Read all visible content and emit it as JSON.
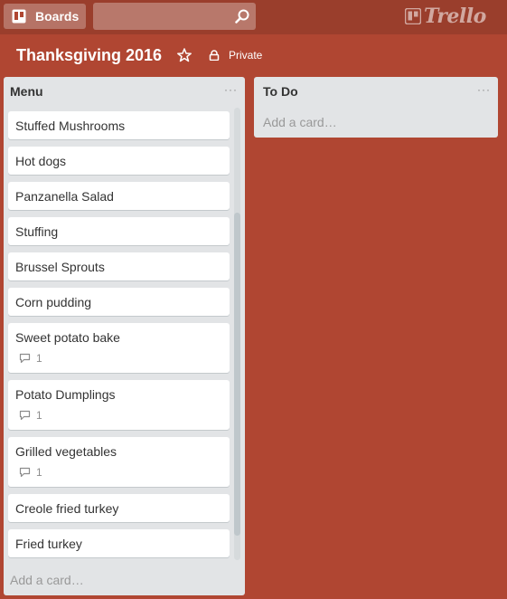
{
  "header": {
    "boards_label": "Boards",
    "search_placeholder": "",
    "logo_text": "Trello"
  },
  "board": {
    "title": "Thanksgiving 2016",
    "privacy": "Private"
  },
  "lists": [
    {
      "title": "Menu",
      "menu_icon": "···",
      "add_card": "Add a card…",
      "cards": [
        {
          "title": "Stuffed Mushrooms"
        },
        {
          "title": "Hot dogs"
        },
        {
          "title": "Panzanella Salad"
        },
        {
          "title": "Stuffing"
        },
        {
          "title": "Brussel Sprouts"
        },
        {
          "title": "Corn pudding"
        },
        {
          "title": "Sweet potato bake",
          "comments": "1"
        },
        {
          "title": "Potato Dumplings",
          "comments": "1"
        },
        {
          "title": "Grilled vegetables",
          "comments": "1"
        },
        {
          "title": "Creole fried turkey"
        },
        {
          "title": "Fried turkey"
        }
      ]
    },
    {
      "title": "To Do",
      "menu_icon": "···",
      "add_card": "Add a card…",
      "cards": []
    }
  ],
  "colors": {
    "board_bg": "#b04632",
    "header_bg": "#9a3e2c",
    "list_bg": "#e2e4e6",
    "card_bg": "#ffffff"
  },
  "icons": [
    "boards-icon",
    "search-icon",
    "trello-logo-icon",
    "star-icon",
    "lock-icon",
    "comment-icon"
  ]
}
